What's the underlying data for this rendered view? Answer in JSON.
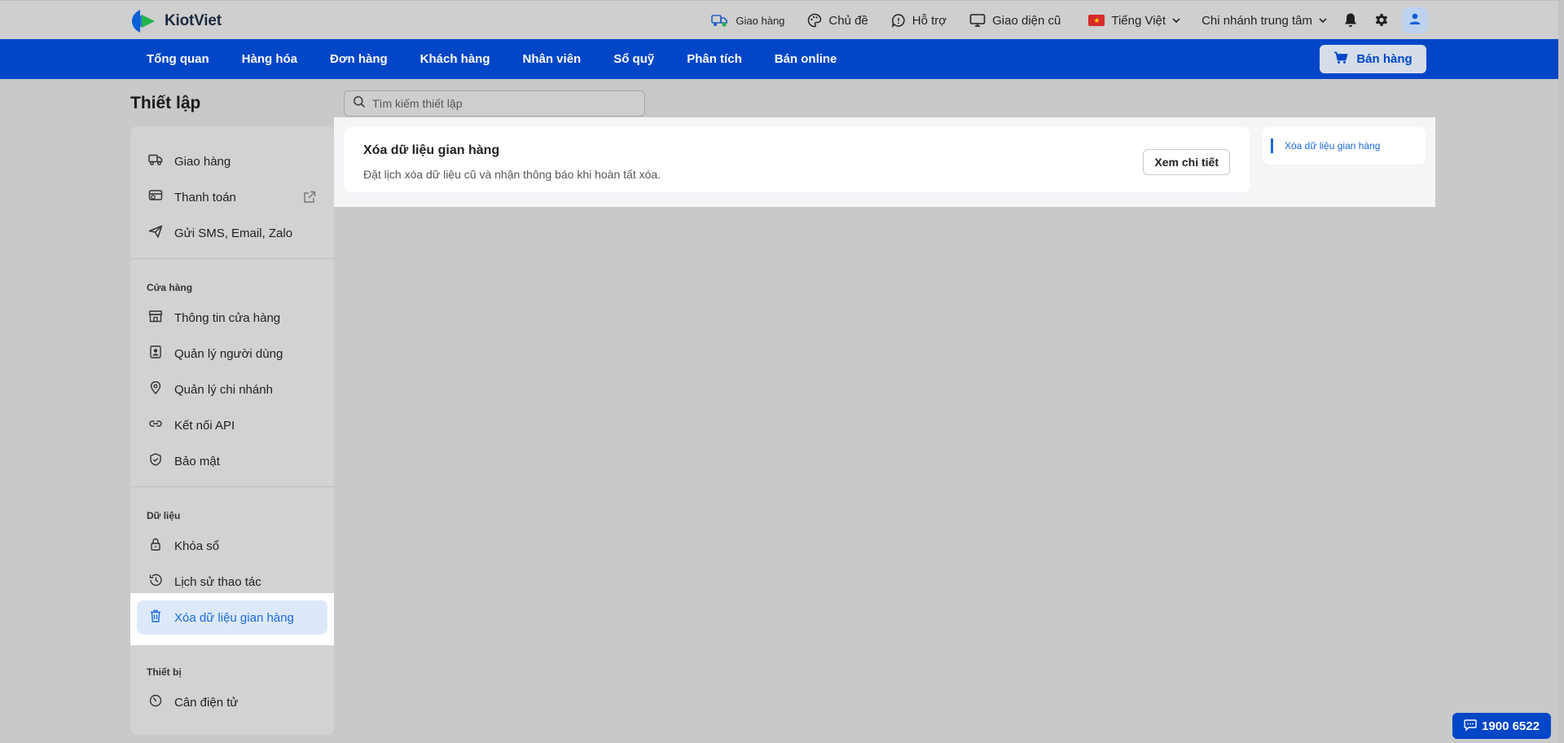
{
  "app": {
    "name": "KiotViet"
  },
  "topbar": {
    "shipping": "Giao hàng",
    "theme": "Chủ đề",
    "support": "Hỗ trợ",
    "old_ui": "Giao diện cũ",
    "language": "Tiếng Việt",
    "branch": "Chi nhánh trung tâm"
  },
  "nav": {
    "items": [
      "Tổng quan",
      "Hàng hóa",
      "Đơn hàng",
      "Khách hàng",
      "Nhân viên",
      "Sổ quỹ",
      "Phân tích",
      "Bán online"
    ],
    "sell_button": "Bán hàng"
  },
  "page": {
    "title": "Thiết lập",
    "search_placeholder": "Tìm kiếm thiết lập"
  },
  "sidebar": {
    "items_top": [
      "Giao hàng",
      "Thanh toán",
      "Gửi SMS, Email, Zalo"
    ],
    "section_store": "Cửa hàng",
    "items_store": [
      "Thông tin cửa hàng",
      "Quản lý người dùng",
      "Quản lý chi nhánh",
      "Kết nối API",
      "Bảo mật"
    ],
    "section_data": "Dữ liệu",
    "items_data": [
      "Khóa sổ",
      "Lịch sử thao tác",
      "Xóa dữ liệu gian hàng"
    ],
    "section_device": "Thiết bị",
    "items_device": [
      "Cân điện tử"
    ]
  },
  "card": {
    "title": "Xóa dữ liệu gian hàng",
    "description": "Đặt lịch xóa dữ liệu cũ và nhận thông báo khi hoàn tất xóa.",
    "button": "Xem chi tiết"
  },
  "toc": {
    "link": "Xóa dữ liệu gian hàng"
  },
  "hotline": "1900 6522",
  "colors": {
    "brand_blue": "#0146c7",
    "accent_blue": "#1a6ad9"
  }
}
